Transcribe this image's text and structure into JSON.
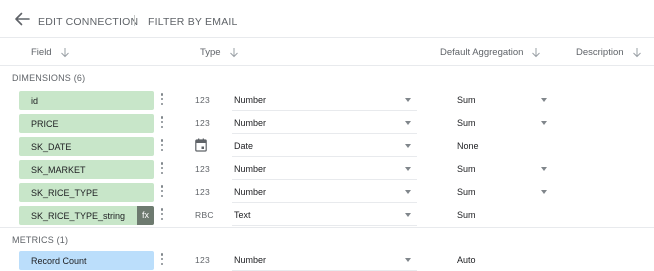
{
  "topbar": {
    "back_icon": "arrow-left-icon",
    "edit_connection": "EDIT CONNECTION",
    "filter_by_email": "FILTER BY EMAIL"
  },
  "columns": {
    "field": "Field",
    "type": "Type",
    "default_aggregation": "Default Aggregation",
    "description": "Description",
    "sort_icon": "arrow-down-icon"
  },
  "dimensions": {
    "label": "DIMENSIONS (6)",
    "fields": [
      {
        "name": "id",
        "type_icon": "123",
        "type": "Number",
        "aggregation": "Sum",
        "agg_dropdown": true
      },
      {
        "name": "PRICE",
        "type_icon": "123",
        "type": "Number",
        "aggregation": "Sum",
        "agg_dropdown": true
      },
      {
        "name": "SK_DATE",
        "type_icon": "calendar-icon",
        "type": "Date",
        "aggregation": "None",
        "agg_dropdown": false
      },
      {
        "name": "SK_MARKET",
        "type_icon": "123",
        "type": "Number",
        "aggregation": "Sum",
        "agg_dropdown": true
      },
      {
        "name": "SK_RICE_TYPE",
        "type_icon": "123",
        "type": "Number",
        "aggregation": "Sum",
        "agg_dropdown": true
      },
      {
        "name": "SK_RICE_TYPE_string",
        "type_icon": "RBC",
        "type": "Text",
        "aggregation": "Sum",
        "agg_dropdown": false,
        "calculated_badge": "fx"
      }
    ]
  },
  "metrics": {
    "label": "METRICS (1)",
    "fields": [
      {
        "name": "Record Count",
        "type_icon": "123",
        "type": "Number",
        "aggregation": "Auto",
        "agg_dropdown": false
      }
    ]
  },
  "colors": {
    "dimension_chip": "#c8e6c9",
    "metric_chip": "#bbdefb",
    "fx_badge": "#6d7a6f"
  }
}
